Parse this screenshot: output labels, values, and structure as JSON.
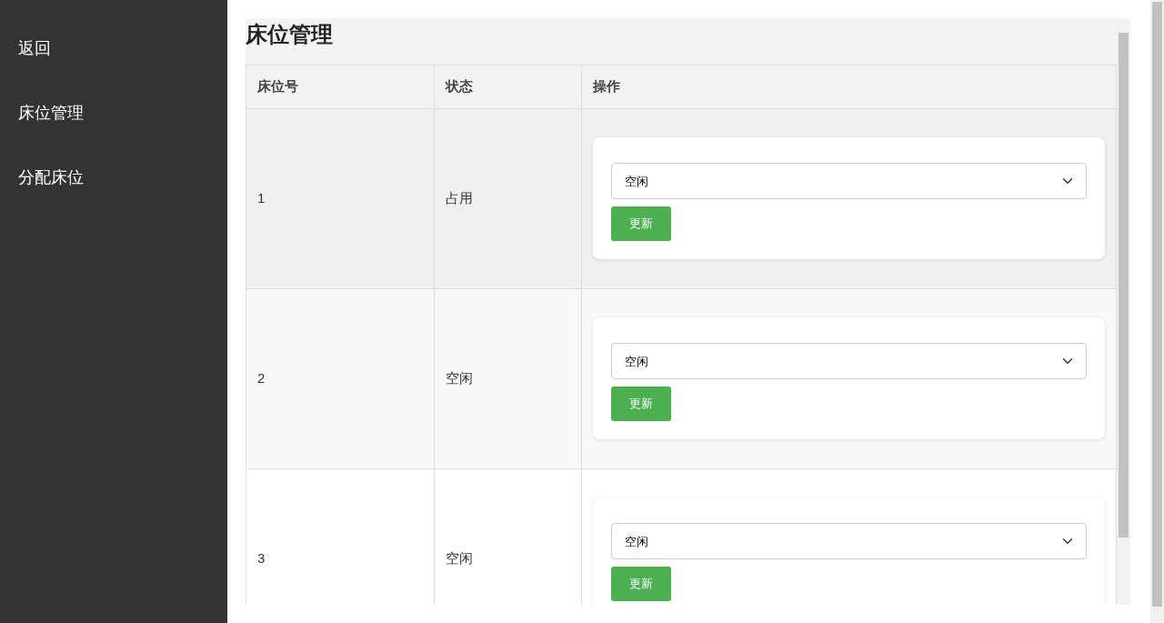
{
  "sidebar": {
    "items": [
      {
        "label": "返回"
      },
      {
        "label": "床位管理"
      },
      {
        "label": "分配床位"
      }
    ]
  },
  "page_title": "床位管理",
  "table": {
    "columns": [
      "床位号",
      "状态",
      "操作"
    ],
    "rows": [
      {
        "bed_no": "1",
        "status": "占用",
        "select_value": "空闲",
        "button": "更新"
      },
      {
        "bed_no": "2",
        "status": "空闲",
        "select_value": "空闲",
        "button": "更新"
      },
      {
        "bed_no": "3",
        "status": "空闲",
        "select_value": "空闲",
        "button": "更新"
      }
    ]
  }
}
